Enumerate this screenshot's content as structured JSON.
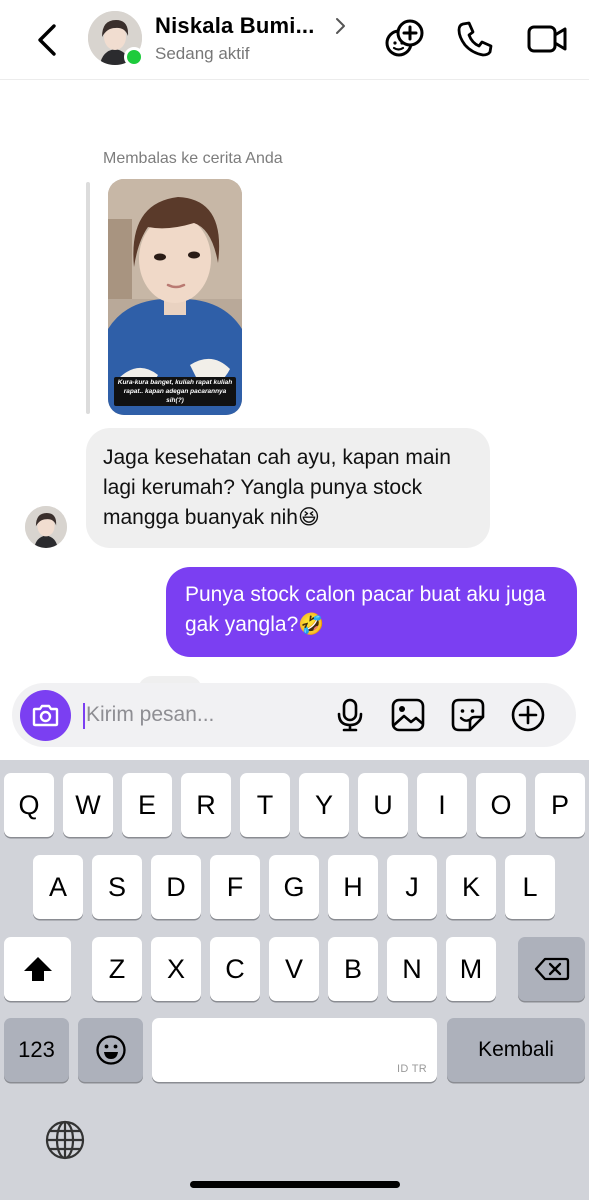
{
  "header": {
    "contact_name": "Niskala Bumi...",
    "status": "Sedang aktif"
  },
  "chat": {
    "reply_label": "Membalas ke cerita Anda",
    "story_caption": "Kura-kura banget, kuliah rapat kuliah rapat.. kapan adegan pacarannya sih(?)",
    "incoming_message": "Jaga kesehatan cah ayu, kapan main lagi kerumah? Yangla punya stock mangga buanyak nih😆",
    "outgoing_message": "Punya stock calon pacar buat aku juga gak yangla?🤣"
  },
  "composer": {
    "placeholder": "Kirim pesan..."
  },
  "keyboard": {
    "row1": [
      "Q",
      "W",
      "E",
      "R",
      "T",
      "Y",
      "U",
      "I",
      "O",
      "P"
    ],
    "row2": [
      "A",
      "S",
      "D",
      "F",
      "G",
      "H",
      "J",
      "K",
      "L"
    ],
    "row3": [
      "Z",
      "X",
      "C",
      "V",
      "B",
      "N",
      "M"
    ],
    "numbers_label": "123",
    "return_label": "Kembali",
    "space_hint": "ID TR"
  },
  "colors": {
    "accent": "#7b3ff2",
    "online": "#1ecb3c",
    "incoming_bubble": "#efefef",
    "keyboard_bg": "#d1d3d9"
  },
  "icons": {
    "back": "chevron-left-icon",
    "add_person": "add-person-icon",
    "call": "phone-icon",
    "video": "video-camera-icon",
    "camera": "camera-icon",
    "mic": "microphone-icon",
    "gallery": "image-icon",
    "sticker": "sticker-icon",
    "plus": "plus-circle-icon",
    "shift": "shift-icon",
    "delete": "backspace-icon",
    "emoji": "emoji-icon",
    "globe": "globe-icon"
  }
}
